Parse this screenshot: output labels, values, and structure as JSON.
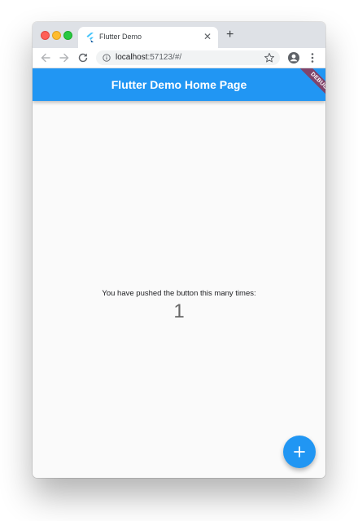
{
  "colors": {
    "primary": "#2196f3",
    "debug_banner": "#a0283c",
    "window_bg": "#fafafa",
    "tabstrip_bg": "#dee1e6"
  },
  "browser": {
    "tab": {
      "title": "Flutter Demo",
      "favicon": "flutter-logo-icon",
      "close_icon": "close-icon"
    },
    "new_tab_icon": "plus-icon",
    "url_host": "localhost",
    "url_rest": ":57123/#/",
    "icons": {
      "back": "back-arrow-icon",
      "forward": "forward-arrow-icon",
      "reload": "reload-icon",
      "info": "info-icon",
      "bookmark": "star-icon",
      "account": "account-icon",
      "menu": "more-vert-icon"
    }
  },
  "app": {
    "title": "Flutter Demo Home Page",
    "debug_label": "DEBUG",
    "counter_label": "You have pushed the button this many times:",
    "counter_value": "1",
    "fab_icon": "add-icon"
  }
}
